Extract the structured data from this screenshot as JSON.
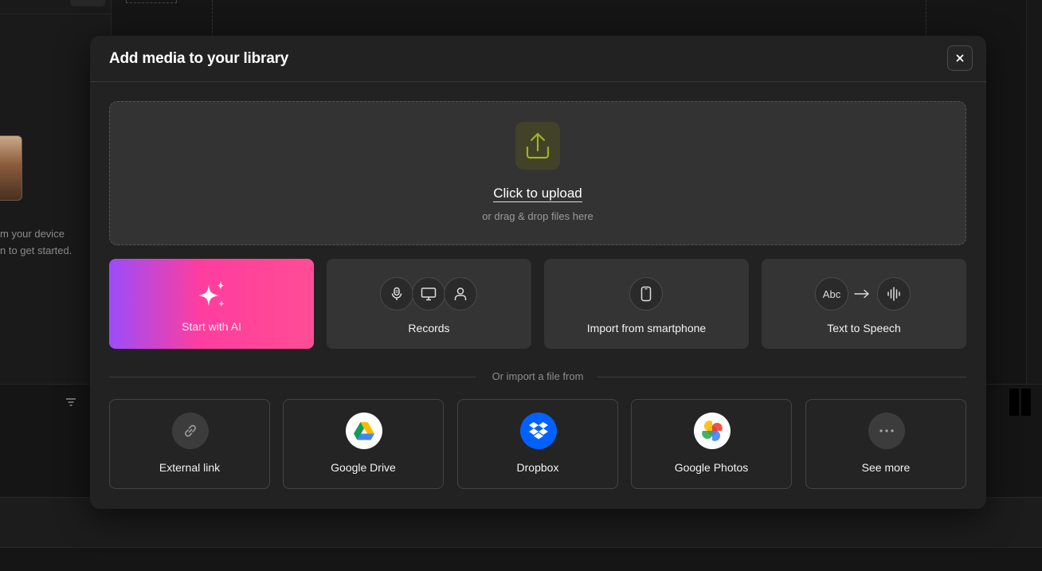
{
  "background": {
    "hint_lines": [
      "m your device",
      "n to get started."
    ]
  },
  "modal": {
    "title": "Add media to your library",
    "close_icon": "close-icon"
  },
  "upload": {
    "title": "Click to upload",
    "subtitle": "or drag & drop files here",
    "icon": "upload-icon",
    "icon_color": "#a4b121"
  },
  "cards": [
    {
      "label": "Start with AI",
      "icon": "sparkles-icon"
    },
    {
      "label": "Records",
      "icons": [
        "microphone-icon",
        "monitor-icon",
        "person-icon"
      ]
    },
    {
      "label": "Import from smartphone",
      "icon": "smartphone-icon"
    },
    {
      "label": "Text to Speech",
      "abc": "Abc",
      "icon": "waveform-icon"
    }
  ],
  "divider_text": "Or import a file from",
  "sources": [
    {
      "label": "External link",
      "icon": "link-icon"
    },
    {
      "label": "Google Drive",
      "icon": "google-drive-icon"
    },
    {
      "label": "Dropbox",
      "icon": "dropbox-icon",
      "color": "#0061fe"
    },
    {
      "label": "Google Photos",
      "icon": "google-photos-icon"
    },
    {
      "label": "See more",
      "icon": "more-icon"
    }
  ],
  "colors": {
    "ai_gradient_start": "#9b4dfa",
    "ai_gradient_end": "#ff4d95"
  }
}
